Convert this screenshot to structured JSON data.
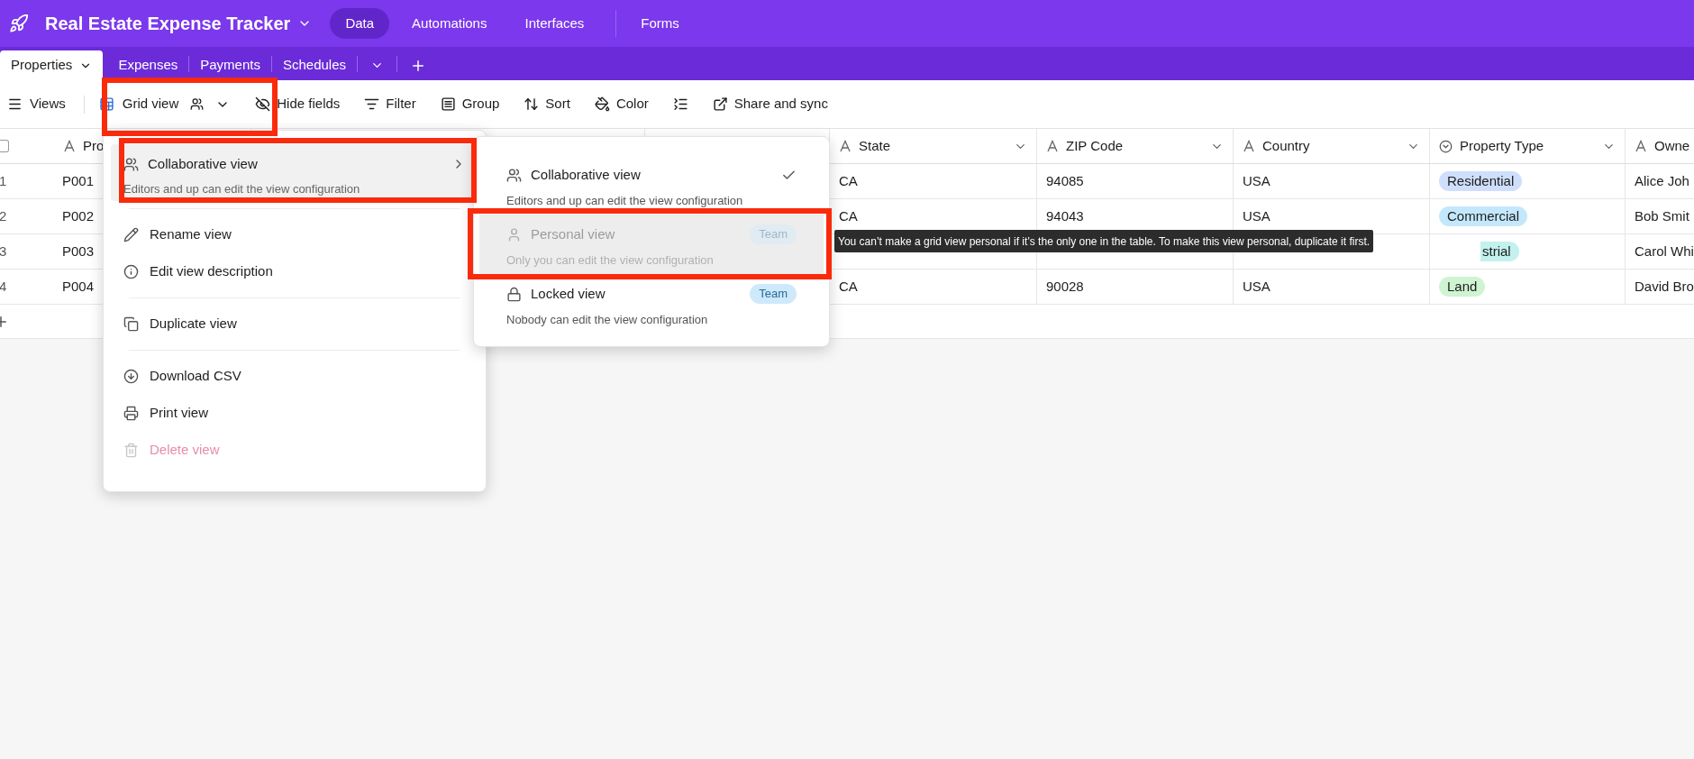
{
  "app": {
    "title": "Real Estate Expense Tracker",
    "nav": [
      {
        "label": "Data",
        "selected": true
      },
      {
        "label": "Automations",
        "selected": false
      },
      {
        "label": "Interfaces",
        "selected": false
      },
      {
        "label": "Forms",
        "selected": false
      }
    ]
  },
  "tables": [
    {
      "label": "Properties",
      "selected": true
    },
    {
      "label": "Expenses",
      "selected": false
    },
    {
      "label": "Payments",
      "selected": false
    },
    {
      "label": "Schedules",
      "selected": false
    }
  ],
  "toolbar": {
    "views_label": "Views",
    "view_name": "Grid view",
    "actions": [
      {
        "kind": "hide",
        "label": "Hide fields"
      },
      {
        "kind": "filter",
        "label": "Filter"
      },
      {
        "kind": "group",
        "label": "Group"
      },
      {
        "kind": "sort",
        "label": "Sort"
      },
      {
        "kind": "color",
        "label": "Color"
      },
      {
        "kind": "row_height"
      },
      {
        "kind": "share",
        "label": "Share and sync"
      }
    ]
  },
  "grid": {
    "select_all_checked": false,
    "primary_header": "Pro",
    "columns": [
      {
        "kind": "text",
        "label": "State"
      },
      {
        "kind": "text",
        "label": "ZIP Code"
      },
      {
        "kind": "text",
        "label": "Country"
      },
      {
        "kind": "select",
        "label": "Property Type"
      },
      {
        "kind": "text",
        "label": "Owne"
      }
    ],
    "rows": [
      {
        "number": "1",
        "id": "P001",
        "cells": [
          "CA",
          "94085",
          "USA",
          {
            "label": "Residential",
            "color": "#cfdffb",
            "clipped": false
          },
          "Alice Joh"
        ]
      },
      {
        "number": "2",
        "id": "P002",
        "cells": [
          "CA",
          "94043",
          "USA",
          {
            "label": "Commercial",
            "color": "#c4e8fb",
            "clipped": false
          },
          "Bob Smit"
        ]
      },
      {
        "number": "3",
        "id": "P003",
        "cells": [
          null,
          null,
          null,
          {
            "label": "strial",
            "color": "#c2f1ee",
            "clipped": true
          },
          "Carol Whi"
        ]
      },
      {
        "number": "4",
        "id": "P004",
        "cells": [
          "CA",
          "90028",
          "USA",
          {
            "label": "Land",
            "color": "#cff4d2",
            "clipped": false
          },
          "David Bro"
        ]
      }
    ]
  },
  "view_menu": [
    {
      "kind": "submenu",
      "label": "Collaborative view",
      "description": "Editors and up can edit the view configuration",
      "highlighted": true
    },
    {
      "kind": "divider"
    },
    {
      "kind": "action",
      "label": "Rename view",
      "disabled": false
    },
    {
      "kind": "action",
      "label": "Edit view description",
      "disabled": false
    },
    {
      "kind": "divider"
    },
    {
      "kind": "action",
      "label": "Duplicate view",
      "disabled": false
    },
    {
      "kind": "divider"
    },
    {
      "kind": "action",
      "label": "Download CSV",
      "disabled": false
    },
    {
      "kind": "action",
      "label": "Print view",
      "disabled": false
    },
    {
      "kind": "action",
      "label": "Delete view",
      "disabled": true
    }
  ],
  "permission_menu": [
    {
      "label": "Collaborative view",
      "description": "Editors and up can edit the view configuration",
      "checked": true,
      "disabled": false,
      "highlighted": false
    },
    {
      "label": "Personal view",
      "description": "Only you can edit the view configuration",
      "badge": "Team",
      "checked": false,
      "disabled": true,
      "highlighted": true
    },
    {
      "label": "Locked view",
      "description": "Nobody can edit the view configuration",
      "badge": "Team",
      "checked": false,
      "disabled": false,
      "highlighted": false
    }
  ],
  "tooltip": "You can’t make a grid view personal if it’s the only one in the table. To make this view personal, duplicate it first."
}
